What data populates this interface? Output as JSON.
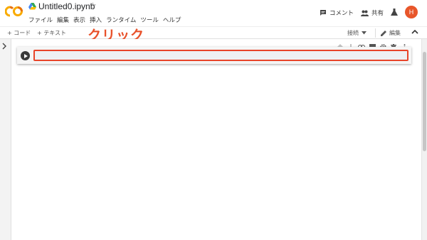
{
  "app": {
    "logo_text": "CO",
    "notebook_title": "Untitled0.ipynb",
    "star_glyph": "☆"
  },
  "menu": [
    "ファイル",
    "編集",
    "表示",
    "挿入",
    "ランタイム",
    "ツール",
    "ヘルプ"
  ],
  "header_actions": {
    "comment_label": "コメント",
    "share_label": "共有",
    "avatar_initial": "H",
    "avatar_color": "#e8562a"
  },
  "toolbar": {
    "add_code_label": "+ コード",
    "add_text_label": "+ テキスト",
    "connect_label": "接続",
    "edit_label": "編集"
  },
  "annotation": {
    "click_label": "クリック",
    "color": "#e8512a"
  },
  "cell_toolbar_icons": [
    "arrow-up-icon",
    "arrow-down-icon",
    "link-icon",
    "comment-icon",
    "gear-icon",
    "delete-icon",
    "more-vert-icon"
  ]
}
